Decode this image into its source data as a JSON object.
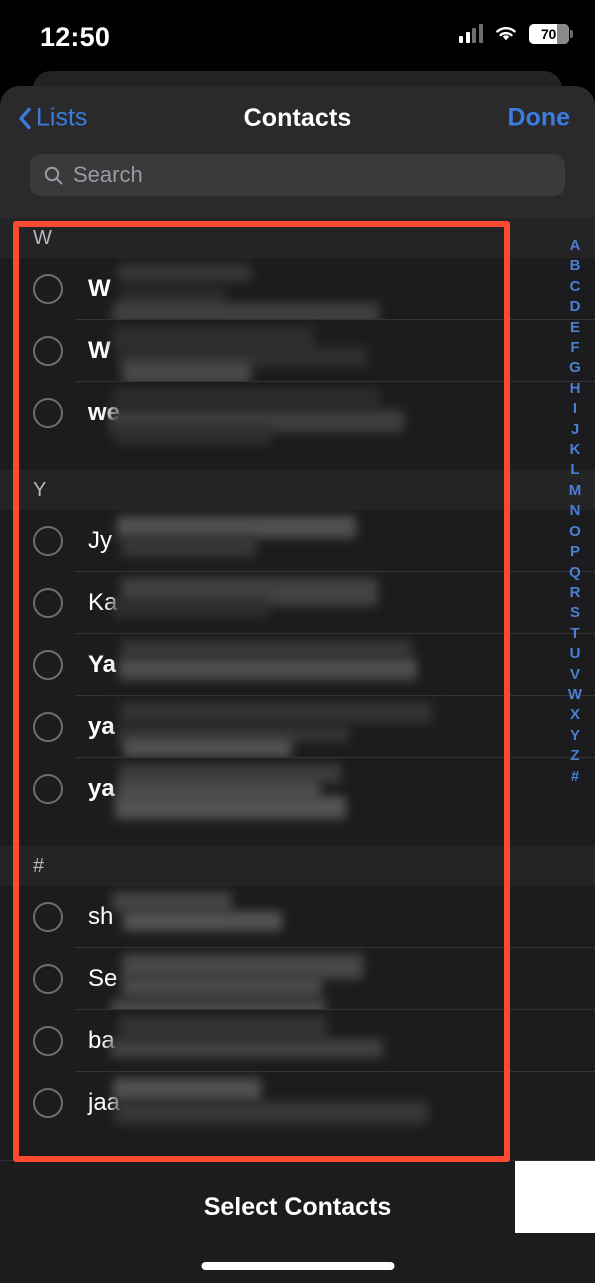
{
  "status_bar": {
    "time": "12:50",
    "cellular_icon": "cellular-signal-icon",
    "wifi_icon": "wifi-icon",
    "battery_icon": "battery-icon",
    "battery_percent": "70"
  },
  "nav_bar": {
    "back_icon": "chevron-left-icon",
    "back_label": "Lists",
    "title": "Contacts",
    "done_label": "Done"
  },
  "search": {
    "icon": "search-icon",
    "placeholder": "Search",
    "value": ""
  },
  "sections": [
    {
      "letter": "W",
      "rows": [
        {
          "name_prefix": "W",
          "redacted": true,
          "bold": true,
          "selected": false
        },
        {
          "name_prefix": "W",
          "redacted": true,
          "bold": true,
          "selected": false
        },
        {
          "name_prefix": "we",
          "redacted": true,
          "bold": true,
          "selected": false
        }
      ]
    },
    {
      "letter": "Y",
      "rows": [
        {
          "name_prefix": "Jy",
          "redacted": true,
          "bold": false,
          "selected": false
        },
        {
          "name_prefix": "Ka",
          "redacted": true,
          "bold": false,
          "selected": false
        },
        {
          "name_prefix": "Ya",
          "redacted": true,
          "bold": true,
          "selected": false
        },
        {
          "name_prefix": "ya",
          "redacted": true,
          "bold": true,
          "selected": false
        },
        {
          "name_prefix": "ya",
          "redacted": true,
          "bold": true,
          "selected": false
        }
      ]
    },
    {
      "letter": "#",
      "rows": [
        {
          "name_prefix": "sh",
          "redacted": true,
          "bold": false,
          "selected": false
        },
        {
          "name_prefix": "Se",
          "redacted": true,
          "bold": false,
          "selected": false
        },
        {
          "name_prefix": "ba",
          "redacted": true,
          "bold": false,
          "selected": false
        },
        {
          "name_prefix": "jaa",
          "redacted": true,
          "bold": false,
          "selected": false
        }
      ]
    }
  ],
  "index_bar": {
    "letters": [
      "A",
      "B",
      "C",
      "D",
      "E",
      "F",
      "G",
      "H",
      "I",
      "J",
      "K",
      "L",
      "M",
      "N",
      "O",
      "P",
      "Q",
      "R",
      "S",
      "T",
      "U",
      "V",
      "W",
      "X",
      "Y",
      "Z",
      "#"
    ]
  },
  "footer": {
    "label": "Select Contacts"
  },
  "annotation": {
    "type": "highlight-rectangle",
    "color": "#fc4a32"
  },
  "colors": {
    "accent_blue": "#3b7ce0",
    "index_blue": "#4a7fd4",
    "sheet_bg": "#1c1c1e",
    "navbar_bg": "#2a2a2c",
    "section_header_bg": "#242426",
    "search_field_bg": "#3a3a3c",
    "separator": "#333335",
    "annotation_red": "#fc4a32"
  }
}
